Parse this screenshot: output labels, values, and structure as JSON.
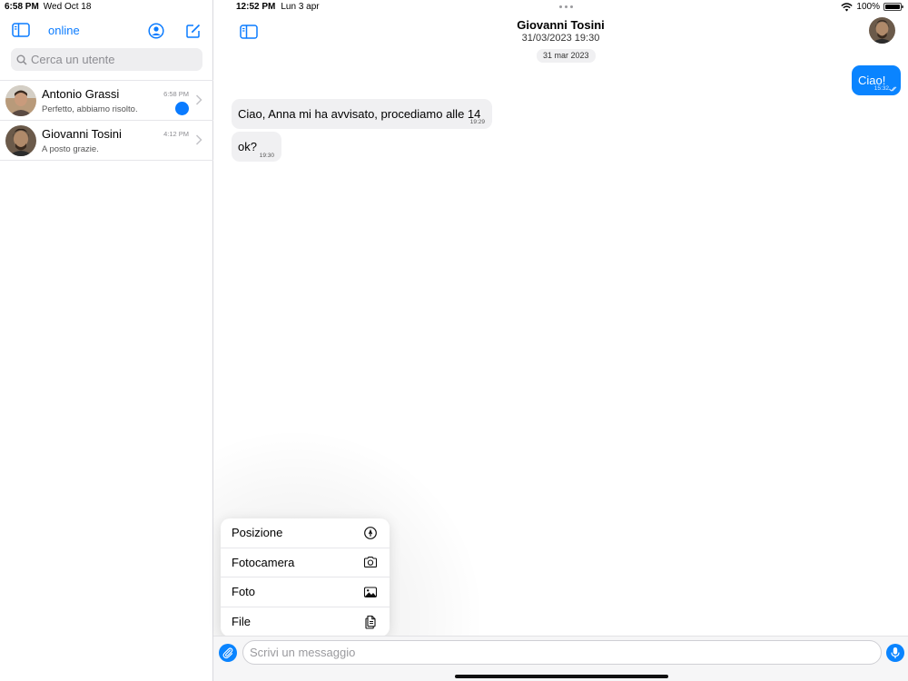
{
  "sidebar": {
    "status_time": "6:58 PM",
    "status_date": "Wed Oct 18",
    "online_label": "online",
    "search_placeholder": "Cerca un utente",
    "conversations": [
      {
        "name": "Antonio Grassi",
        "preview": "Perfetto, abbiamo risolto.",
        "time": "6:58 PM",
        "unread": true
      },
      {
        "name": "Giovanni Tosini",
        "preview": "A posto grazie.",
        "time": "4:12 PM",
        "unread": false
      }
    ]
  },
  "chat": {
    "status_time": "12:52 PM",
    "status_date": "Lun 3 apr",
    "battery": "100%",
    "contact_name": "Giovanni Tosini",
    "contact_subtitle": "31/03/2023 19:30",
    "date_chip": "31 mar 2023",
    "messages": [
      {
        "direction": "out",
        "text": "Ciao!",
        "time": "15:32"
      },
      {
        "direction": "in",
        "text": "Ciao, Anna mi ha avvisato, procediamo alle 14",
        "time": "19:29"
      },
      {
        "direction": "in",
        "text": "ok?",
        "time": "19:30"
      }
    ],
    "attach_menu": [
      {
        "label": "Posizione",
        "icon": "location-icon"
      },
      {
        "label": "Fotocamera",
        "icon": "camera-icon"
      },
      {
        "label": "Foto",
        "icon": "photo-icon"
      },
      {
        "label": "File",
        "icon": "file-icon"
      }
    ],
    "composer_placeholder": "Scrivi un messaggio"
  },
  "colors": {
    "accent": "#0a84ff",
    "bubble_in": "#f0f0f2"
  }
}
